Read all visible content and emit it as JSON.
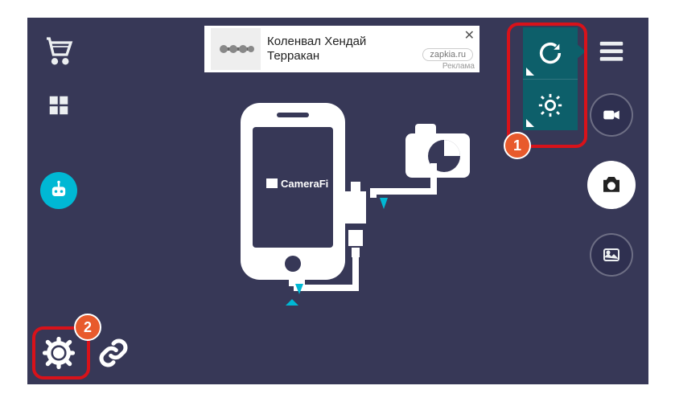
{
  "ad": {
    "title_line1": "Коленвал Хендай",
    "title_line2": "Терракан",
    "domain": "zapkia.ru",
    "label": "Реклама",
    "close": "✕"
  },
  "illustration": {
    "brand_label": "CameraFi",
    "brand_icon": "camerafi-logo"
  },
  "left_sidebar": {
    "cart": "cart-icon",
    "grid": "grid-icon",
    "robot": "robot-icon"
  },
  "bottom_left": {
    "settings": "gear-icon",
    "link": "link-icon"
  },
  "right_sidebar": {
    "menu": "menu-icon",
    "video": "video-icon",
    "photo": "camera-icon",
    "gallery": "gallery-icon"
  },
  "popover": {
    "rotate": "rotate-icon",
    "brightness": "brightness-icon"
  },
  "callouts": {
    "badge1": "1",
    "badge2": "2"
  },
  "colors": {
    "app_bg": "#373857",
    "accent_cyan": "#00b8d4",
    "popover_bg": "#0d5f6a",
    "highlight_red": "#d8121a",
    "badge_orange": "#e85a2c"
  }
}
